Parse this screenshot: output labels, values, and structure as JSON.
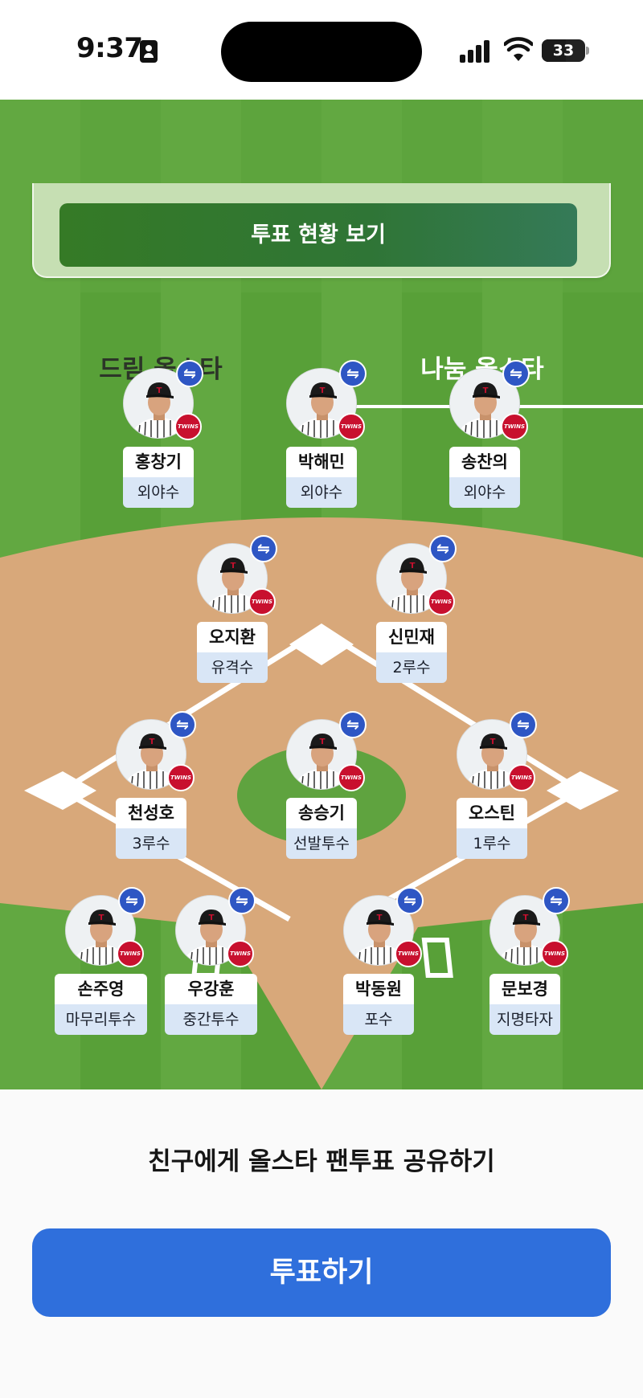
{
  "status_bar": {
    "time": "9:37",
    "battery": "33",
    "icons": [
      "id-card-icon",
      "signal-icon",
      "wifi-icon",
      "battery-icon"
    ]
  },
  "vote_status_button": "투표 현황 보기",
  "tabs": [
    {
      "label": "드림 올스타",
      "selected": false
    },
    {
      "label": "나눔 올스타",
      "selected": true
    }
  ],
  "team_logo_text": "TWINS",
  "swap_icon": "⇋",
  "players": [
    {
      "name": "홍창기",
      "position": "외야수"
    },
    {
      "name": "박해민",
      "position": "외야수"
    },
    {
      "name": "송찬의",
      "position": "외야수"
    },
    {
      "name": "오지환",
      "position": "유격수"
    },
    {
      "name": "신민재",
      "position": "2루수"
    },
    {
      "name": "천성호",
      "position": "3루수"
    },
    {
      "name": "송승기",
      "position": "선발투수"
    },
    {
      "name": "오스틴",
      "position": "1루수"
    },
    {
      "name": "손주영",
      "position": "마무리투수"
    },
    {
      "name": "우강훈",
      "position": "중간투수"
    },
    {
      "name": "박동원",
      "position": "포수"
    },
    {
      "name": "문보경",
      "position": "지명타자"
    }
  ],
  "share_text": "친구에게 올스타 팬투표 공유하기",
  "vote_button": "투표하기",
  "colors": {
    "accent": "#2f6fdc",
    "grass": "#5fa33f",
    "dirt": "#d8a87a",
    "swap_badge": "#2e56c4",
    "team": "#c8102e"
  }
}
